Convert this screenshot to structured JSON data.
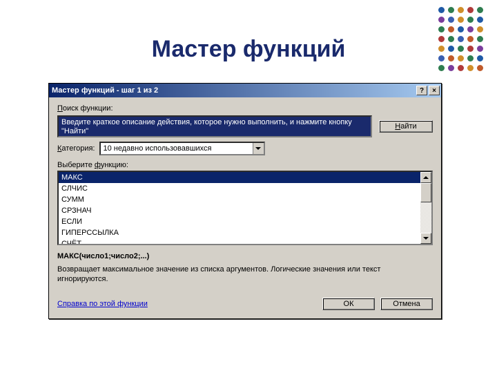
{
  "slide": {
    "title": "Мастер функций"
  },
  "decor": {
    "dots": [
      "#1f5aa6",
      "#2e7d4f",
      "#d08f2a",
      "#b03a3a",
      "#2e7d4f",
      "#7a3d9c",
      "#3a5fb0",
      "#d08f2a",
      "#2e7d4f",
      "#1f5aa6",
      "#2e7d4f",
      "#c05a2a",
      "#1f5aa6",
      "#7a3d9c",
      "#d08f2a",
      "#b03a3a",
      "#2e7d4f",
      "#3a5fb0",
      "#c05a2a",
      "#2e7d4f",
      "#d08f2a",
      "#1f5aa6",
      "#2e7d4f",
      "#b03a3a",
      "#7a3d9c",
      "#3a5fb0",
      "#c05a2a",
      "#d08f2a",
      "#2e7d4f",
      "#1f5aa6",
      "#2e7d4f",
      "#7a3d9c",
      "#b03a3a",
      "#d08f2a",
      "#c05a2a"
    ]
  },
  "dialog": {
    "title": "Мастер функций - шаг 1 из 2",
    "help_btn": "?",
    "close_btn": "×",
    "search_label_pre": "П",
    "search_label_rest": "оиск функции:",
    "search_text": "Введите краткое описание действия, которое нужно выполнить, и нажмите кнопку \"Найти\"",
    "find_u": "Н",
    "find_rest": "айти",
    "category_u": "К",
    "category_rest": "атегория:",
    "category_value": "10 недавно использовавшихся",
    "select_label_pre": "Выберите ",
    "select_label_u": "ф",
    "select_label_rest": "ункцию:",
    "functions": [
      "МАКС",
      "СЛЧИС",
      "СУММ",
      "СРЗНАЧ",
      "ЕСЛИ",
      "ГИПЕРССЫЛКА",
      "СЧЁТ"
    ],
    "syntax": "МАКС(число1;число2;...)",
    "description": "Возвращает максимальное значение из списка аргументов. Логические значения или текст игнорируются.",
    "help_link": "Справка по этой функции",
    "ok": "ОК",
    "cancel": "Отмена"
  }
}
